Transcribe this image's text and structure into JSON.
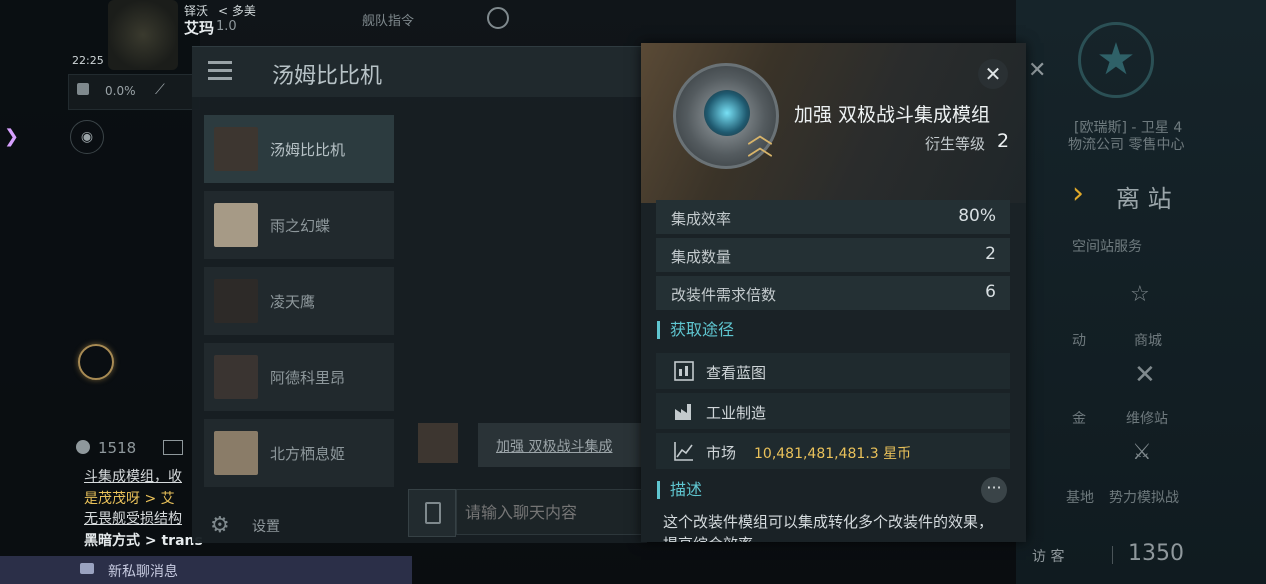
{
  "top_left": {
    "player_name": "艾玛",
    "level": "1.0",
    "system": "铎沃",
    "route": "< 多美",
    "clock": "22:25",
    "stat_percent": "0.0%"
  },
  "top_bar": {
    "fleet_command": "舰队指令"
  },
  "chat": {
    "title": "汤姆比比机",
    "contacts": [
      {
        "name": "汤姆比比机"
      },
      {
        "name": "雨之幻蝶"
      },
      {
        "name": "凌天鹰"
      },
      {
        "name": "阿德科里昂"
      },
      {
        "name": "北方栖息姬"
      }
    ],
    "settings_label": "设置",
    "input_placeholder": "请输入聊天内容",
    "message_link": "加强 双极战斗集成"
  },
  "bottom_left": {
    "online_count": "1518",
    "log_lines": [
      "斗集成模组，收",
      "是茂茂呀 > 艾",
      "无畏舰受损结构",
      "黑暗方式 > trans"
    ],
    "new_private_msg": "新私聊消息"
  },
  "item": {
    "name": "加强 双极战斗集成模组",
    "tier_label": "衍生等级",
    "tier_value": "2",
    "stats": [
      {
        "label": "集成效率",
        "value": "80%"
      },
      {
        "label": "集成数量",
        "value": "2"
      },
      {
        "label": "改装件需求倍数",
        "value": "6"
      }
    ],
    "acquire_title": "获取途径",
    "sources": [
      {
        "label": "查看蓝图",
        "icon": "blueprint-icon"
      },
      {
        "label": "工业制造",
        "icon": "factory-icon"
      },
      {
        "label": "市场",
        "icon": "market-chart-icon",
        "price": "10,481,481,481.3 星币"
      }
    ],
    "desc_title": "描述",
    "description": "这个改装件模组可以集成转化多个改装件的效果，提高综合效率"
  },
  "station": {
    "location": "[欧瑞斯] - 卫星 4",
    "corp": "物流公司 零售中心",
    "undock": "离 站",
    "services_title": "空间站服务",
    "services": [
      "商城",
      "维修站",
      "势力模拟战"
    ],
    "partial_labels": [
      "动",
      "金",
      "基地"
    ],
    "visitors_label": "访 客",
    "visitors_count": "1350"
  },
  "colors": {
    "accent": "#5fc6d0",
    "price": "#e9c15a",
    "undock_arrow": "#e0a92a"
  }
}
